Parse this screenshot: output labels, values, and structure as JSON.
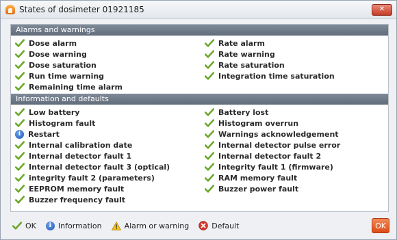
{
  "window": {
    "title": "States of dosimeter 01921185",
    "close_label": "✕"
  },
  "sections": {
    "alarms": {
      "header": "Alarms and warnings",
      "left": [
        "Dose alarm",
        "Dose warning",
        "Dose saturation",
        "Run time warning",
        "Remaining time alarm"
      ],
      "right": [
        "Rate alarm",
        "Rate warning",
        "Rate saturation",
        "Integration time saturation"
      ]
    },
    "info": {
      "header": "Information and defaults",
      "left": [
        "Low battery",
        "Histogram fault",
        "Restart",
        "Internal calibration date",
        "Internal detector fault 1",
        "Internal detector fault 3 (optical)",
        "integrity fault 2 (parameters)",
        "EEPROM memory fault",
        "Buzzer frequency fault"
      ],
      "right": [
        "Battery lost",
        "Histogram overrun",
        "Warnings acknowledgement",
        "Internal detector pulse error",
        "Internal detector fault 2",
        "Integrity fault 1 (firmware)",
        "RAM memory fault",
        "Buzzer power fault"
      ]
    }
  },
  "legend": {
    "ok": "OK",
    "information": "Information",
    "alarm": "Alarm or warning",
    "default": "Default"
  },
  "ok_button": "OK",
  "colors": {
    "check": "#6aa82a",
    "section_header": "#6e7988",
    "ok_button": "#e2561c"
  }
}
